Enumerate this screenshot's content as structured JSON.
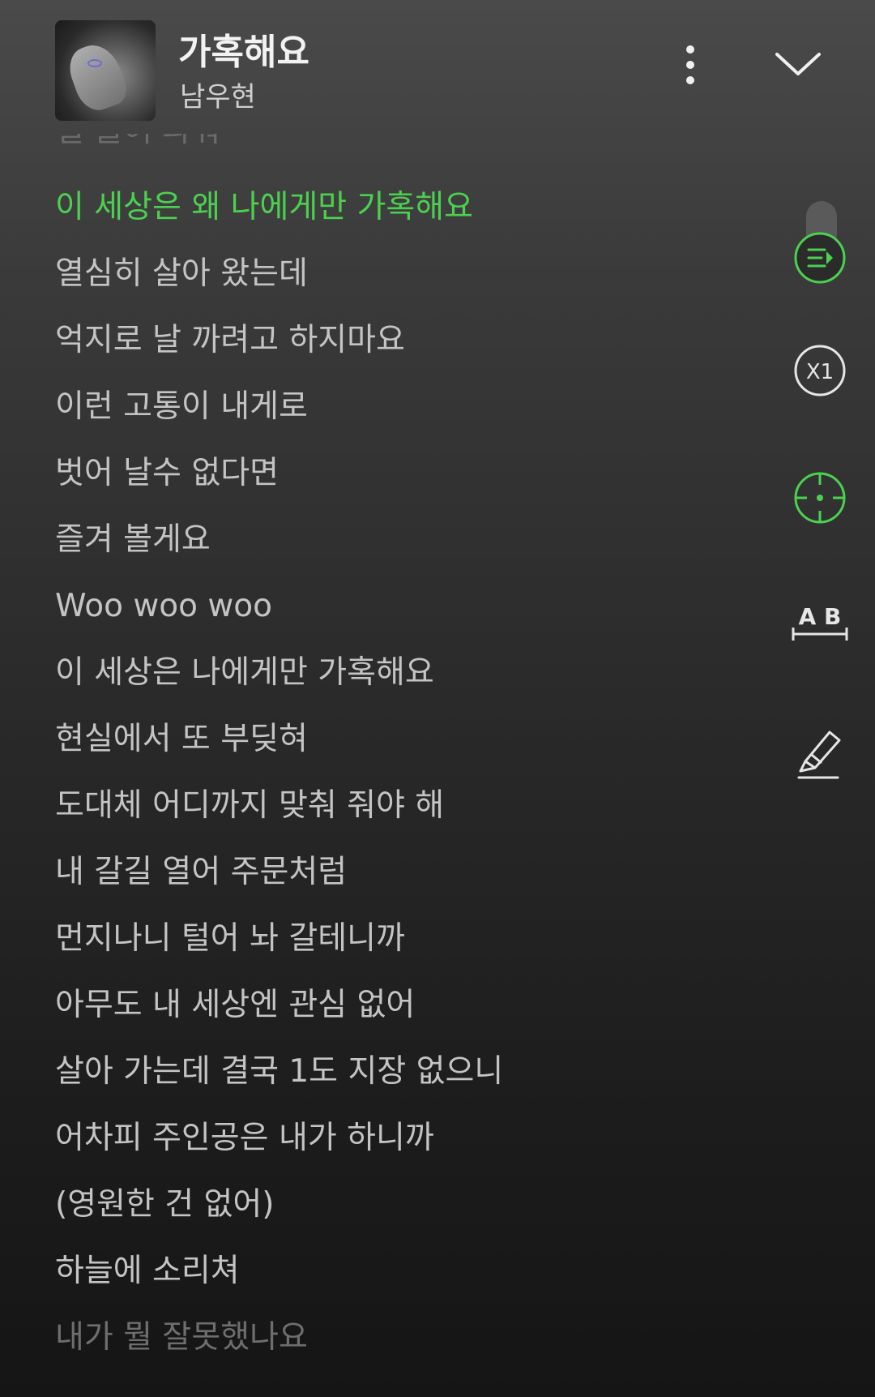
{
  "header": {
    "title": "가혹해요",
    "artist": "남우현",
    "more_icon": "more-vertical-icon",
    "collapse_icon": "chevron-down-icon"
  },
  "lyrics": {
    "faded_top": "길 들어 파워",
    "active": "이 세상은 왜 나에게만 가혹해요",
    "lines": [
      "열심히 살아 왔는데",
      "억지로 날 까려고 하지마요",
      "이런 고통이 내게로",
      "벗어 날수 없다면",
      "즐겨 볼게요",
      "Woo woo woo",
      "이 세상은 나에게만 가혹해요",
      "현실에서 또 부딪혀",
      "도대체 어디까지 맞춰 줘야 해",
      "내 갈길 열어 주문처럼",
      "먼지나니 털어 놔 갈테니까",
      "아무도 내 세상엔 관심 없어",
      "살아 가는데 결국 1도 지장 없으니",
      "어차피 주인공은 내가 하니까",
      "(영원한 건 없어)",
      "하늘에 소리쳐"
    ],
    "faded_bottom": "내가 뭘 잘못했나요"
  },
  "side_controls": {
    "speed_label": "X1",
    "ab_label": "A B",
    "icons": [
      "lyrics-scroll-icon",
      "speed-icon",
      "sync-center-icon",
      "ab-repeat-icon",
      "highlight-pen-icon"
    ]
  },
  "colors": {
    "accent": "#4bd14f",
    "text": "#c4c4c4",
    "title": "#f2f2f2"
  }
}
